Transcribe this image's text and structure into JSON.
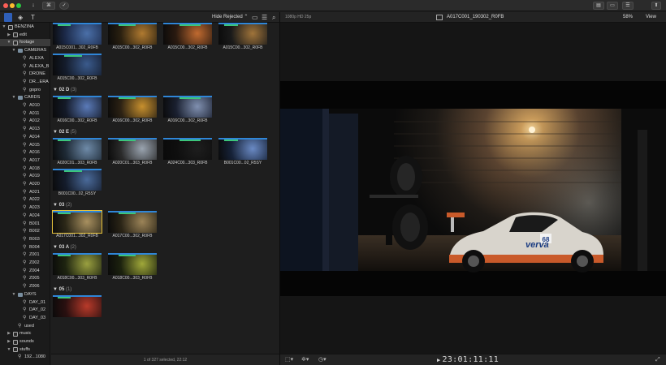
{
  "toolbar": {
    "download_icon": "↓",
    "keyword_btn": "⌘",
    "check_icon": "✓",
    "layout_icons": [
      "▤",
      "▭",
      "☰",
      "⬆"
    ]
  },
  "subbar": {
    "hide_rejected": "Hide Rejected",
    "hide_rejected_caret": "⌃",
    "format_label": "1080p HD 25p",
    "clip_title": "A017C001_190302_R0FB",
    "zoom": "58%",
    "view_label": "View"
  },
  "sidebar": {
    "items": [
      {
        "label": "BENZINA",
        "indent": 0,
        "tri": "▼",
        "icon": "box",
        "selected": false
      },
      {
        "label": "edit",
        "indent": 1,
        "tri": "▶",
        "icon": "box",
        "selected": false
      },
      {
        "label": "footage",
        "indent": 1,
        "tri": "▼",
        "icon": "box",
        "selected": true
      },
      {
        "label": "CAMERAS",
        "indent": 2,
        "tri": "▼",
        "icon": "folder",
        "selected": false
      },
      {
        "label": "ALEXA",
        "indent": 3,
        "tri": "",
        "icon": "key",
        "selected": false
      },
      {
        "label": "ALEXA_B",
        "indent": 3,
        "tri": "",
        "icon": "key",
        "selected": false
      },
      {
        "label": "DRONE",
        "indent": 3,
        "tri": "",
        "icon": "key",
        "selected": false
      },
      {
        "label": "DR...ERA",
        "indent": 3,
        "tri": "",
        "icon": "key",
        "selected": false
      },
      {
        "label": "gopro",
        "indent": 3,
        "tri": "",
        "icon": "key",
        "selected": false
      },
      {
        "label": "CARDS",
        "indent": 2,
        "tri": "▼",
        "icon": "folder",
        "selected": false
      },
      {
        "label": "A010",
        "indent": 3,
        "tri": "",
        "icon": "key",
        "selected": false
      },
      {
        "label": "A011",
        "indent": 3,
        "tri": "",
        "icon": "key",
        "selected": false
      },
      {
        "label": "A012",
        "indent": 3,
        "tri": "",
        "icon": "key",
        "selected": false
      },
      {
        "label": "A013",
        "indent": 3,
        "tri": "",
        "icon": "key",
        "selected": false
      },
      {
        "label": "A014",
        "indent": 3,
        "tri": "",
        "icon": "key",
        "selected": false
      },
      {
        "label": "A015",
        "indent": 3,
        "tri": "",
        "icon": "key",
        "selected": false
      },
      {
        "label": "A016",
        "indent": 3,
        "tri": "",
        "icon": "key",
        "selected": false
      },
      {
        "label": "A017",
        "indent": 3,
        "tri": "",
        "icon": "key",
        "selected": false
      },
      {
        "label": "A018",
        "indent": 3,
        "tri": "",
        "icon": "key",
        "selected": false
      },
      {
        "label": "A019",
        "indent": 3,
        "tri": "",
        "icon": "key",
        "selected": false
      },
      {
        "label": "A020",
        "indent": 3,
        "tri": "",
        "icon": "key",
        "selected": false
      },
      {
        "label": "A021",
        "indent": 3,
        "tri": "",
        "icon": "key",
        "selected": false
      },
      {
        "label": "A022",
        "indent": 3,
        "tri": "",
        "icon": "key",
        "selected": false
      },
      {
        "label": "A023",
        "indent": 3,
        "tri": "",
        "icon": "key",
        "selected": false
      },
      {
        "label": "A024",
        "indent": 3,
        "tri": "",
        "icon": "key",
        "selected": false
      },
      {
        "label": "B001",
        "indent": 3,
        "tri": "",
        "icon": "key",
        "selected": false
      },
      {
        "label": "B002",
        "indent": 3,
        "tri": "",
        "icon": "key",
        "selected": false
      },
      {
        "label": "B003",
        "indent": 3,
        "tri": "",
        "icon": "key",
        "selected": false
      },
      {
        "label": "B004",
        "indent": 3,
        "tri": "",
        "icon": "key",
        "selected": false
      },
      {
        "label": "Z001",
        "indent": 3,
        "tri": "",
        "icon": "key",
        "selected": false
      },
      {
        "label": "Z002",
        "indent": 3,
        "tri": "",
        "icon": "key",
        "selected": false
      },
      {
        "label": "Z004",
        "indent": 3,
        "tri": "",
        "icon": "key",
        "selected": false
      },
      {
        "label": "Z005",
        "indent": 3,
        "tri": "",
        "icon": "key",
        "selected": false
      },
      {
        "label": "Z006",
        "indent": 3,
        "tri": "",
        "icon": "key",
        "selected": false
      },
      {
        "label": "DAYS",
        "indent": 2,
        "tri": "▼",
        "icon": "folder",
        "selected": false
      },
      {
        "label": "DAY_01",
        "indent": 3,
        "tri": "",
        "icon": "key",
        "selected": false
      },
      {
        "label": "DAY_02",
        "indent": 3,
        "tri": "",
        "icon": "key",
        "selected": false
      },
      {
        "label": "DAY_03",
        "indent": 3,
        "tri": "",
        "icon": "key",
        "selected": false
      },
      {
        "label": "used",
        "indent": 2,
        "tri": "",
        "icon": "key",
        "selected": false
      },
      {
        "label": "music",
        "indent": 1,
        "tri": "▶",
        "icon": "box",
        "selected": false
      },
      {
        "label": "sounds",
        "indent": 1,
        "tri": "▶",
        "icon": "box",
        "selected": false
      },
      {
        "label": "stuffs",
        "indent": 1,
        "tri": "▼",
        "icon": "box",
        "selected": false
      },
      {
        "label": "192...1080",
        "indent": 2,
        "tri": "",
        "icon": "key",
        "selected": false
      }
    ]
  },
  "browser": {
    "groups": [
      {
        "header": null,
        "count": null,
        "clips": [
          {
            "name": "A015C001...302_R0FB",
            "selected": false
          },
          {
            "name": "A015C00...302_R0FB",
            "selected": false
          },
          {
            "name": "A015C00...302_R0FB",
            "selected": false
          },
          {
            "name": "A015C00...302_R0FB",
            "selected": false
          },
          {
            "name": "A015C00...302_R0FB",
            "selected": false
          }
        ]
      },
      {
        "header": "02 D",
        "count": "(3)",
        "clips": [
          {
            "name": "A016C00...302_R0FB",
            "selected": false
          },
          {
            "name": "A016C00...302_R0FB",
            "selected": false
          },
          {
            "name": "A016C00...302_R0FB",
            "selected": false
          }
        ]
      },
      {
        "header": "02 E",
        "count": "(5)",
        "clips": [
          {
            "name": "A020C01...303_R0FB",
            "selected": false
          },
          {
            "name": "A020C01...303_R0FB",
            "selected": false
          },
          {
            "name": "A024C00...303_R0FB",
            "selected": false
          },
          {
            "name": "B001C00...02_R5SY",
            "selected": false
          },
          {
            "name": "B001C00...02_R5SY",
            "selected": false
          }
        ]
      },
      {
        "header": "03",
        "count": "(2)",
        "clips": [
          {
            "name": "A017C001...302_R0FB",
            "selected": true
          },
          {
            "name": "A017C00...302_R0FB",
            "selected": false
          }
        ]
      },
      {
        "header": "03 A",
        "count": "(2)",
        "clips": [
          {
            "name": "A018C00...303_R0FB",
            "selected": false
          },
          {
            "name": "A018C00...303_R0FB",
            "selected": false
          }
        ]
      },
      {
        "header": "05",
        "count": "(1)",
        "clips": [
          {
            "name": "",
            "selected": false
          }
        ]
      }
    ],
    "status": "1 of 327 selected, 22:12"
  },
  "viewer": {
    "timecode": "23:01:11:11",
    "play_icon": "▶",
    "livery": "verva",
    "race_number": "68"
  },
  "colors": {
    "accent_blue": "#2f86d8",
    "favorite_green": "#3cc57a",
    "selection_yellow": "#e6c23c"
  }
}
